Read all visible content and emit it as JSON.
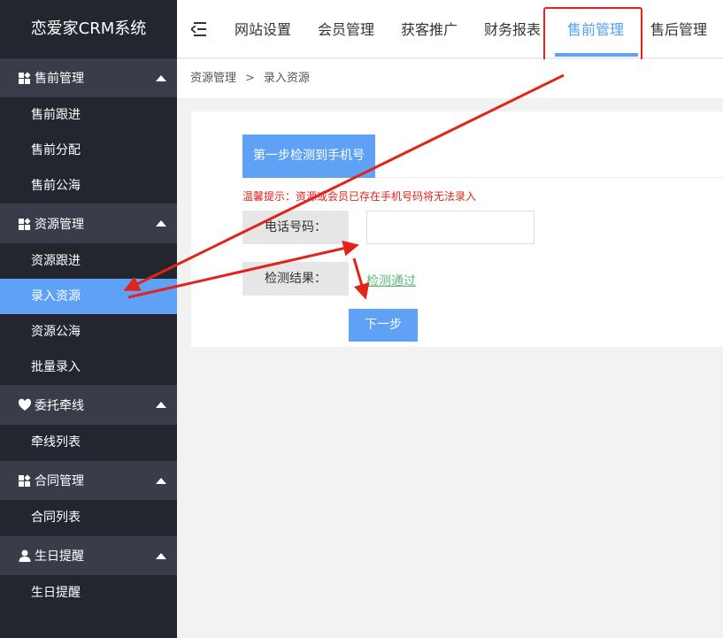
{
  "brand": "恋爱家CRM系统",
  "sidebar": {
    "groups": [
      {
        "label": "售前管理",
        "icon": "squares-icon",
        "items": [
          "售前跟进",
          "售前分配",
          "售前公海"
        ]
      },
      {
        "label": "资源管理",
        "icon": "squares-icon",
        "items": [
          "资源跟进",
          "录入资源",
          "资源公海",
          "批量录入"
        ]
      },
      {
        "label": "委托牵线",
        "icon": "heart-icon",
        "items": [
          "牵线列表"
        ]
      },
      {
        "label": "合同管理",
        "icon": "squares-icon",
        "items": [
          "合同列表"
        ]
      },
      {
        "label": "生日提醒",
        "icon": "user-icon",
        "items": [
          "生日提醒"
        ]
      }
    ],
    "active_item": "录入资源"
  },
  "topnav": {
    "items": [
      "网站设置",
      "会员管理",
      "获客推广",
      "财务报表",
      "售前管理",
      "售后管理"
    ],
    "active": "售前管理"
  },
  "breadcrumb": {
    "items": [
      "资源管理",
      "录入资源"
    ],
    "separator": ">"
  },
  "form": {
    "step_label": "第一步检测到手机号",
    "tip": "温馨提示：资源或会员已存在手机号码将无法录入",
    "phone_label": "电话号码：",
    "phone_value": "",
    "result_label": "检测结果：",
    "result_value": "检测通过",
    "next_label": "下一步"
  },
  "colors": {
    "accent": "#5fa2f5",
    "sidebar": "#23262e",
    "group": "#393d49",
    "annotation": "#e2231a",
    "success": "#5fb878"
  }
}
